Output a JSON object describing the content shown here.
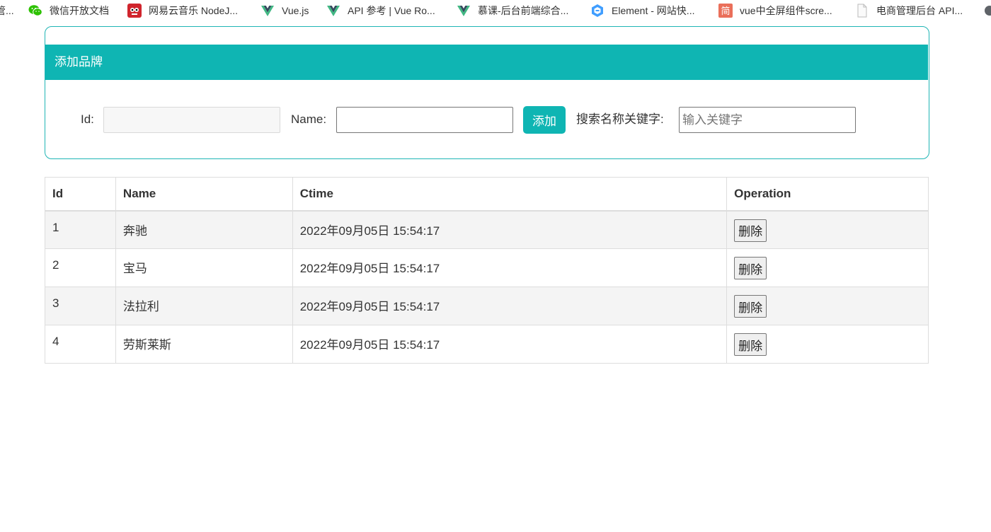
{
  "bookmarks": [
    {
      "label": "管...",
      "icon": "truncated-item"
    },
    {
      "label": "微信开放文档",
      "icon": "wechat-icon"
    },
    {
      "label": "网易云音乐 NodeJ...",
      "icon": "netease-music-icon"
    },
    {
      "label": "Vue.js",
      "icon": "vue-icon"
    },
    {
      "label": "API 参考 | Vue Ro...",
      "icon": "vue-icon"
    },
    {
      "label": "慕课-后台前端综合...",
      "icon": "vue-icon"
    },
    {
      "label": "Element - 网站快...",
      "icon": "element-icon"
    },
    {
      "label": "vue中全屏组件scre...",
      "icon": "jianshu-icon"
    },
    {
      "label": "电商管理后台 API...",
      "icon": "page-icon"
    },
    {
      "label": "",
      "icon": "overflow-icon"
    }
  ],
  "panel": {
    "title": "添加品牌",
    "id_label": "Id:",
    "id_value": "",
    "name_label": "Name:",
    "name_value": "",
    "add_button": "添加",
    "search_label": "搜索名称关键字:",
    "search_placeholder": "输入关键字"
  },
  "table": {
    "headers": [
      "Id",
      "Name",
      "Ctime",
      "Operation"
    ],
    "rows": [
      {
        "id": "1",
        "name": "奔驰",
        "ctime": "2022年09月05日 15:54:17",
        "action": "删除"
      },
      {
        "id": "2",
        "name": "宝马",
        "ctime": "2022年09月05日 15:54:17",
        "action": "删除"
      },
      {
        "id": "3",
        "name": "法拉利",
        "ctime": "2022年09月05日 15:54:17",
        "action": "删除"
      },
      {
        "id": "4",
        "name": "劳斯莱斯",
        "ctime": "2022年09月05日 15:54:17",
        "action": "删除"
      }
    ]
  },
  "colors": {
    "accent": "#0fb5b3",
    "panel_border": "#1fb5b5",
    "stripe": "#f4f4f4",
    "table_border": "#dddddd"
  }
}
